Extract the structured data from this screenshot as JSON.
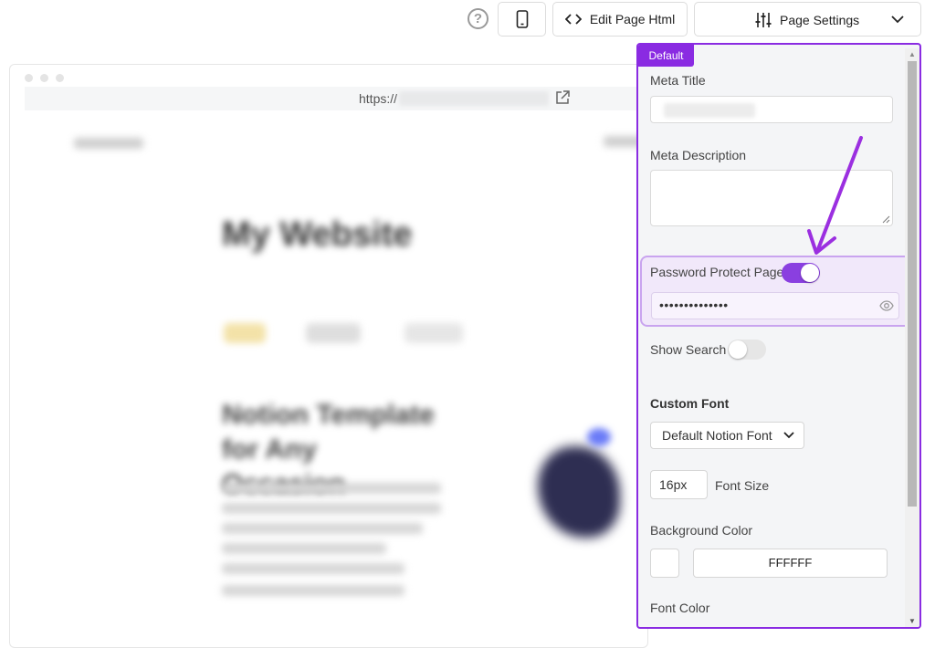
{
  "toolbar": {
    "help_glyph": "?",
    "edit_html_label": "Edit Page Html",
    "settings_label": "Page Settings"
  },
  "preview": {
    "url_prefix": "https://",
    "site_title": "My Website",
    "heading": "Notion Template for Any Occasion"
  },
  "panel": {
    "tag": "Default",
    "meta_title_label": "Meta Title",
    "meta_description_label": "Meta Description",
    "password_label": "Password Protect Page",
    "password_enabled": true,
    "password_value": "••••••••••••••",
    "show_search_label": "Show Search",
    "show_search_enabled": false,
    "custom_font_title": "Custom Font",
    "font_select_value": "Default Notion Font",
    "font_size_value": "16px",
    "font_size_label": "Font Size",
    "bg_color_label": "Background Color",
    "bg_color_hex": "FFFFFF",
    "font_color_label": "Font Color"
  },
  "colors": {
    "accent": "#8a2be2",
    "toggle_on": "#8a3fe0",
    "panel_bg": "#f4f5f7"
  },
  "icons": [
    "help-icon",
    "mobile-icon",
    "code-icon",
    "sliders-icon",
    "chevron-down-icon",
    "external-link-icon",
    "eye-icon"
  ]
}
